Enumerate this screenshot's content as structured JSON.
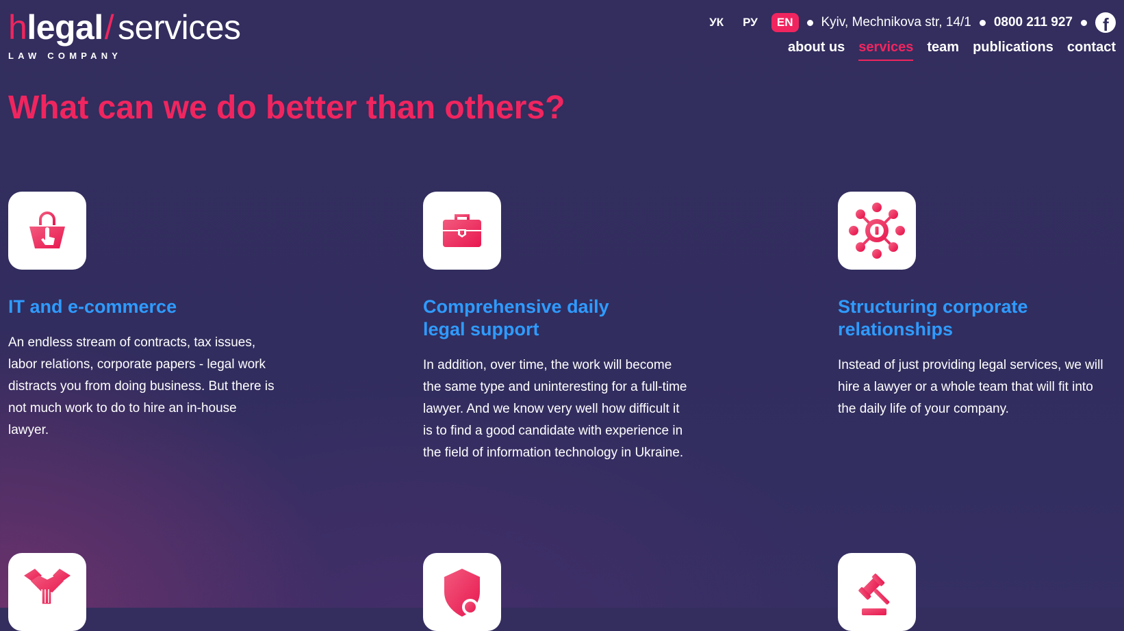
{
  "colors": {
    "accent": "#f0255f",
    "title_blue": "#2f9bff",
    "background": "#312d5e"
  },
  "logo": {
    "h": "h",
    "legal": "legal",
    "slash": "/",
    "services": "services",
    "subtitle": "LAW COMPANY"
  },
  "languages": [
    "УК",
    "РУ",
    "EN"
  ],
  "active_language": "EN",
  "contact": {
    "address": "Kyiv, Mechnikova str, 14/1",
    "phone": "0800 211 927",
    "social_icon": "facebook-icon"
  },
  "nav": [
    {
      "label": "about us"
    },
    {
      "label": "services"
    },
    {
      "label": "team"
    },
    {
      "label": "publications"
    },
    {
      "label": "contact"
    }
  ],
  "active_nav": "services",
  "page_title": "What can we do better than others?",
  "cards": [
    {
      "icon": "shopping-basket-icon",
      "title": "IT and e-commerce",
      "text": "An endless stream of contracts, tax issues, labor relations, corporate papers - legal work distracts you from doing business. But there is not much work to do to hire an in-house lawyer."
    },
    {
      "icon": "briefcase-icon",
      "title": "Comprehensive daily\nlegal support",
      "text": "In addition, over time, the work will become the same type and uninteresting for a full-time lawyer. And we know very well how difficult it is to find a good candidate with experience in the field of information technology in Ukraine."
    },
    {
      "icon": "network-hub-icon",
      "title": "Structuring corporate\nrelationships",
      "text": "Instead of just providing legal services, we will hire a lawyer or a whole team that will fit into the daily life of your company."
    },
    {
      "icon": "handshake-icon"
    },
    {
      "icon": "shield-icon"
    },
    {
      "icon": "gavel-icon"
    }
  ]
}
